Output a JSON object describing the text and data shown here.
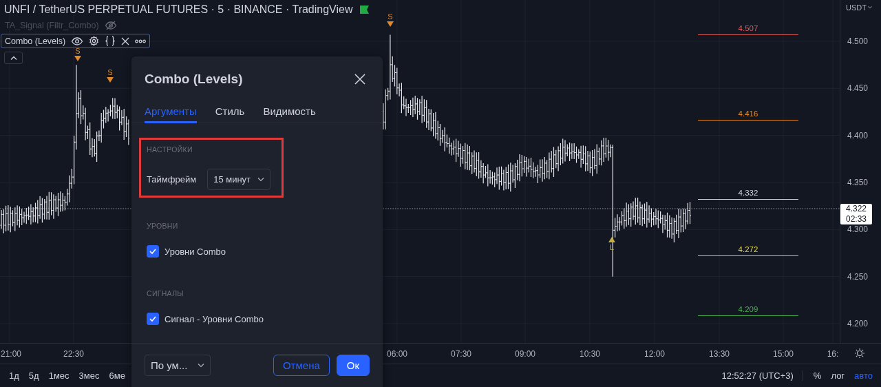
{
  "header": {
    "title": "UNFI / TetherUS PERPETUAL FUTURES · 5 · BINANCE · TradingView",
    "indicators": [
      {
        "name": "TA_Signal (Filtr_Combo)",
        "hidden": true,
        "selected": false
      },
      {
        "name": "Combo (Levels)",
        "hidden": false,
        "selected": true
      }
    ]
  },
  "price_axis": {
    "currency": "USDT",
    "ticks": [
      "4.500",
      "4.450",
      "4.400",
      "4.350",
      "4.300",
      "4.250",
      "4.200"
    ],
    "last_price": "4.322",
    "countdown": "02:33"
  },
  "time_axis": {
    "ticks": [
      "21:00",
      "22:30",
      "06:00",
      "07:30",
      "09:00",
      "10:30",
      "12:00",
      "13:30",
      "15:00",
      "16:"
    ]
  },
  "levels": [
    {
      "value": "4.507",
      "color": "#e05a5a"
    },
    {
      "value": "4.416",
      "color": "#e0892b"
    },
    {
      "value": "4.332",
      "color": "#d1d4dc"
    },
    {
      "value": "4.272",
      "color": "#e3d144"
    },
    {
      "value": "4.209",
      "color": "#4caf50"
    }
  ],
  "signals": [
    {
      "kind": "short",
      "label": "S"
    },
    {
      "kind": "short",
      "label": "S"
    },
    {
      "kind": "short",
      "label": "S"
    },
    {
      "kind": "long",
      "label": "L"
    }
  ],
  "dialog": {
    "title": "Combo (Levels)",
    "tabs": [
      {
        "label": "Аргументы",
        "selected": true
      },
      {
        "label": "Стиль",
        "selected": false
      },
      {
        "label": "Видимость",
        "selected": false
      }
    ],
    "sections": [
      {
        "heading": "НАСТРОЙКИ",
        "highlighted": true,
        "rows": [
          {
            "kind": "select",
            "label": "Таймфрейм",
            "value": "15 минут"
          }
        ]
      },
      {
        "heading": "УРОВНИ",
        "highlighted": false,
        "rows": [
          {
            "kind": "checkbox",
            "label": "Уровни Combo",
            "checked": true
          }
        ]
      },
      {
        "heading": "СИГНАЛЫ",
        "highlighted": false,
        "rows": [
          {
            "kind": "checkbox",
            "label": "Сигнал - Уровни Combo",
            "checked": true
          }
        ]
      }
    ],
    "footer": {
      "preset": "По ум...",
      "cancel": "Отмена",
      "ok": "Ок"
    }
  },
  "bottom_bar": {
    "ranges": [
      "1д",
      "5д",
      "1мес",
      "3мес",
      "6ме"
    ],
    "clock": "12:52:27 (UTC+3)",
    "toggles": [
      {
        "label": "%",
        "selected": false
      },
      {
        "label": "лог",
        "selected": false
      },
      {
        "label": "авто",
        "selected": true
      }
    ]
  }
}
